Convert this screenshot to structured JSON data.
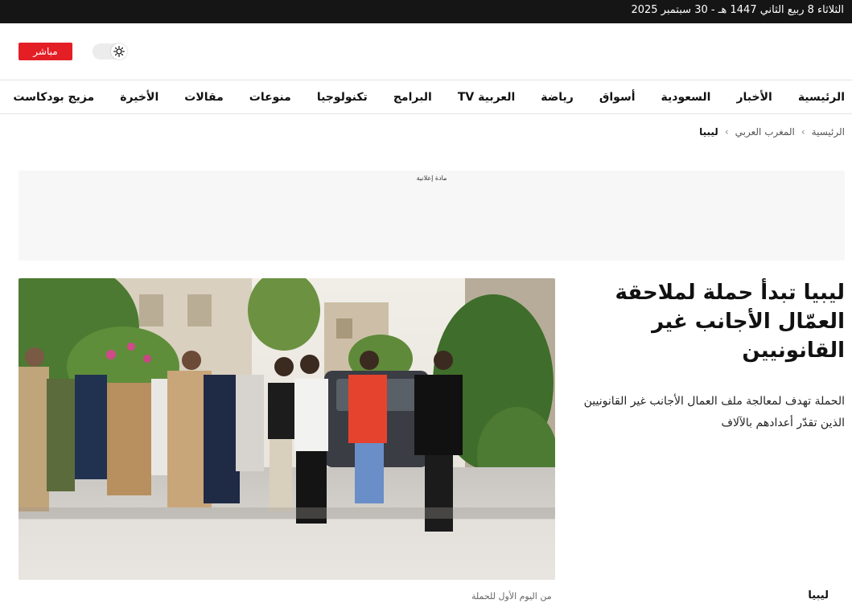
{
  "topbar": {
    "date": "الثلاثاء 8 ربيع الثاني 1447 هـ - 30 سبتمبر 2025"
  },
  "header": {
    "live_label": "مباشر",
    "theme_icon": "sun-icon"
  },
  "nav": {
    "items": [
      {
        "label": "الرئيسية"
      },
      {
        "label": "الأخبار"
      },
      {
        "label": "السعودية"
      },
      {
        "label": "أسواق"
      },
      {
        "label": "رياضة"
      },
      {
        "label": "العربية TV"
      },
      {
        "label": "البرامج"
      },
      {
        "label": "تكنولوجيا"
      },
      {
        "label": "منوعات"
      },
      {
        "label": "مقالات"
      },
      {
        "label": "الأخيرة"
      },
      {
        "label": "مزيج بودكاست"
      }
    ]
  },
  "breadcrumb": {
    "home": "الرئيسية",
    "section": "المغرب العربي",
    "current": "ليبيا"
  },
  "ad": {
    "label": "مادة إعلانية"
  },
  "article": {
    "title": "ليبيا تبدأ حملة لملاحقة العمّال الأجانب غير القانونيين",
    "summary": "الحملة تهدف لمعالجة ملف العمال الأجانب غير القانونيين الذين تقدّر أعدادهم بالآلاف",
    "image_caption": "من اليوم الأول للحملة",
    "tag": "ليبيا"
  },
  "colors": {
    "live": "#e31e24",
    "topbar": "#151515"
  }
}
